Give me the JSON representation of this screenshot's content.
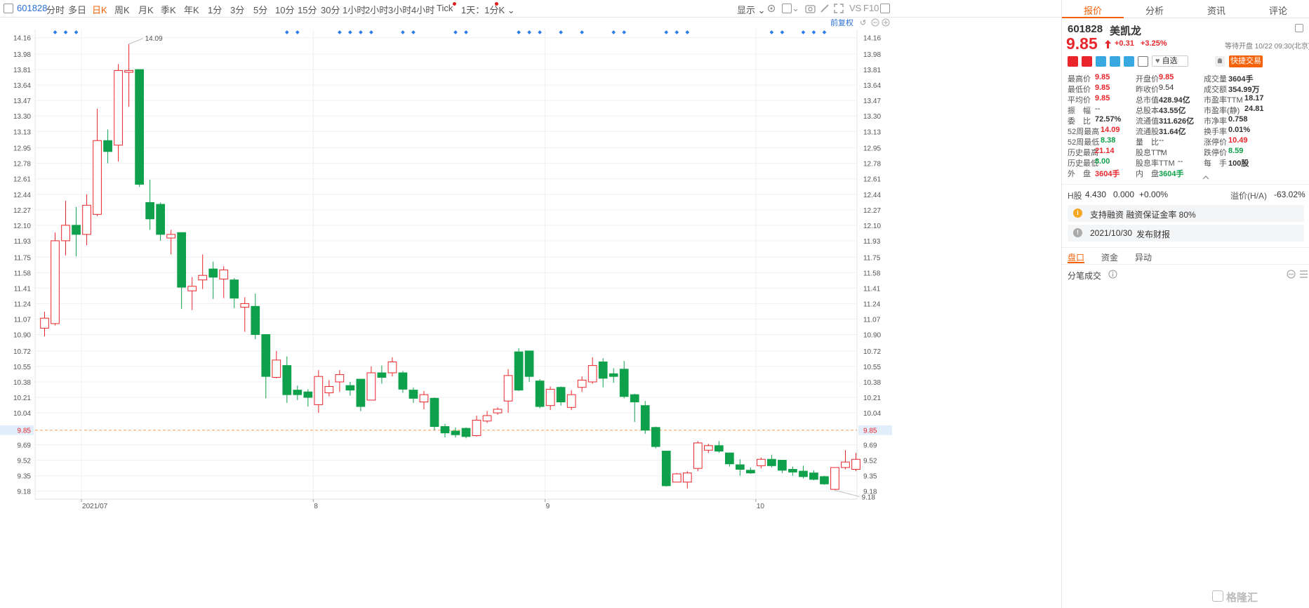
{
  "toolbar": {
    "code": "601828",
    "periods": [
      "分时",
      "多日",
      "日K",
      "周K",
      "月K",
      "季K",
      "年K",
      "1分",
      "3分",
      "5分",
      "10分",
      "15分",
      "30分",
      "1小时",
      "2小时",
      "3小时",
      "4小时",
      "Tick"
    ],
    "active_period": "日K",
    "subperiod": "1天：1分K",
    "display": "显示",
    "vs": "VS",
    "f10": "F10"
  },
  "chart": {
    "adjust_label": "前复权",
    "y_ticks": [
      "14.16",
      "13.98",
      "13.81",
      "13.64",
      "13.47",
      "13.30",
      "13.13",
      "12.95",
      "12.78",
      "12.61",
      "12.44",
      "12.27",
      "12.10",
      "11.93",
      "11.75",
      "11.58",
      "11.41",
      "11.24",
      "11.07",
      "10.90",
      "10.72",
      "10.55",
      "10.38",
      "10.21",
      "10.04",
      "9.85",
      "9.69",
      "9.52",
      "9.35",
      "9.18"
    ],
    "current_price_label": "9.85",
    "x_labels": [
      "2021/07",
      "8",
      "9",
      "10"
    ],
    "high_annotation": "14.09",
    "low_annotation": "9.18"
  },
  "chart_data": {
    "type": "candlestick",
    "ylim": [
      9.1,
      14.25
    ],
    "current_price": 9.85,
    "month_starts": [
      {
        "label": "2021/07",
        "index": 4
      },
      {
        "label": "8",
        "index": 26
      },
      {
        "label": "9",
        "index": 48
      },
      {
        "label": "10",
        "index": 68
      }
    ],
    "candles": [
      [
        10.97,
        11.08,
        11.15,
        10.88
      ],
      [
        11.02,
        11.93,
        12.02,
        11.0
      ],
      [
        11.93,
        12.1,
        12.37,
        11.77
      ],
      [
        12.1,
        12.0,
        12.3,
        11.76
      ],
      [
        12.0,
        12.32,
        12.44,
        11.88
      ],
      [
        12.22,
        13.03,
        13.38,
        12.2
      ],
      [
        13.03,
        12.91,
        13.15,
        12.78
      ],
      [
        12.98,
        13.8,
        13.87,
        12.8
      ],
      [
        13.78,
        13.8,
        14.09,
        13.4
      ],
      [
        13.81,
        12.55,
        13.81,
        12.52
      ],
      [
        12.35,
        12.17,
        12.6,
        12.05
      ],
      [
        12.33,
        12.0,
        12.35,
        11.93
      ],
      [
        11.96,
        12.0,
        12.05,
        11.78
      ],
      [
        12.02,
        11.42,
        12.02,
        11.18
      ],
      [
        11.38,
        11.43,
        11.53,
        11.17
      ],
      [
        11.5,
        11.55,
        11.78,
        11.4
      ],
      [
        11.62,
        11.53,
        11.7,
        11.29
      ],
      [
        11.51,
        11.61,
        11.65,
        11.3
      ],
      [
        11.5,
        11.3,
        11.52,
        11.19
      ],
      [
        11.2,
        11.24,
        11.31,
        10.93
      ],
      [
        11.21,
        10.9,
        11.35,
        10.85
      ],
      [
        10.9,
        10.44,
        10.9,
        10.2
      ],
      [
        10.43,
        10.62,
        10.72,
        10.42
      ],
      [
        10.56,
        10.24,
        10.66,
        10.15
      ],
      [
        10.29,
        10.24,
        10.34,
        10.18
      ],
      [
        10.27,
        10.21,
        10.3,
        10.11
      ],
      [
        10.13,
        10.44,
        10.51,
        10.04
      ],
      [
        10.26,
        10.33,
        10.4,
        10.22
      ],
      [
        10.38,
        10.46,
        10.51,
        10.27
      ],
      [
        10.34,
        10.29,
        10.38,
        10.23
      ],
      [
        10.41,
        10.11,
        10.41,
        10.06
      ],
      [
        10.18,
        10.48,
        10.55,
        10.18
      ],
      [
        10.48,
        10.43,
        10.56,
        10.36
      ],
      [
        10.48,
        10.6,
        10.65,
        10.44
      ],
      [
        10.48,
        10.3,
        10.5,
        10.26
      ],
      [
        10.29,
        10.2,
        10.32,
        10.15
      ],
      [
        10.16,
        10.24,
        10.28,
        10.08
      ],
      [
        10.2,
        9.89,
        10.21,
        9.85
      ],
      [
        9.89,
        9.82,
        9.92,
        9.77
      ],
      [
        9.84,
        9.8,
        9.88,
        9.77
      ],
      [
        9.87,
        9.78,
        9.88,
        9.76
      ],
      [
        9.79,
        9.96,
        10.01,
        9.78
      ],
      [
        9.95,
        10.01,
        10.06,
        9.93
      ],
      [
        10.04,
        10.08,
        10.1,
        10.02
      ],
      [
        10.17,
        10.45,
        10.52,
        10.04
      ],
      [
        10.71,
        10.29,
        10.75,
        10.28
      ],
      [
        10.72,
        10.44,
        10.72,
        10.38
      ],
      [
        10.39,
        10.11,
        10.41,
        10.09
      ],
      [
        10.12,
        10.3,
        10.33,
        10.07
      ],
      [
        10.32,
        10.16,
        10.33,
        10.12
      ],
      [
        10.1,
        10.24,
        10.29,
        10.07
      ],
      [
        10.32,
        10.4,
        10.44,
        10.27
      ],
      [
        10.38,
        10.56,
        10.65,
        10.36
      ],
      [
        10.6,
        10.42,
        10.64,
        10.32
      ],
      [
        10.47,
        10.44,
        10.53,
        10.37
      ],
      [
        10.52,
        10.22,
        10.61,
        10.2
      ],
      [
        10.24,
        10.16,
        10.25,
        9.94
      ],
      [
        10.12,
        9.85,
        10.17,
        9.81
      ],
      [
        9.88,
        9.67,
        9.89,
        9.65
      ],
      [
        9.62,
        9.24,
        9.62,
        9.23
      ],
      [
        9.28,
        9.37,
        9.38,
        9.3
      ],
      [
        9.28,
        9.38,
        9.4,
        9.21
      ],
      [
        9.43,
        9.71,
        9.73,
        9.4
      ],
      [
        9.63,
        9.68,
        9.7,
        9.6
      ],
      [
        9.68,
        9.62,
        9.73,
        9.6
      ],
      [
        9.6,
        9.48,
        9.6,
        9.45
      ],
      [
        9.47,
        9.42,
        9.53,
        9.35
      ],
      [
        9.41,
        9.38,
        9.44,
        9.37
      ],
      [
        9.46,
        9.53,
        9.55,
        9.43
      ],
      [
        9.53,
        9.46,
        9.58,
        9.44
      ],
      [
        9.52,
        9.41,
        9.52,
        9.38
      ],
      [
        9.42,
        9.39,
        9.45,
        9.35
      ],
      [
        9.4,
        9.34,
        9.46,
        9.32
      ],
      [
        9.38,
        9.31,
        9.41,
        9.3
      ],
      [
        9.34,
        9.26,
        9.35,
        9.25
      ],
      [
        9.2,
        9.44,
        9.44,
        9.19
      ],
      [
        9.44,
        9.5,
        9.63,
        9.42
      ],
      [
        9.42,
        9.53,
        9.6,
        9.4
      ]
    ]
  },
  "panel": {
    "tabs": [
      "报价",
      "分析",
      "资讯",
      "评论"
    ],
    "active_tab": "报价",
    "code": "601828",
    "name": "美凯龙",
    "price": "9.85",
    "change": "+0.31",
    "change_pct": "+3.25%",
    "status": "等待开盘 10/22 09:30(北京)",
    "watch_label": "自选",
    "quick_trade": "快捷交易",
    "stats": [
      [
        {
          "label": "最高价",
          "value": "9.85",
          "color": "red"
        },
        {
          "label": "开盘价",
          "value": "9.85",
          "color": "red"
        },
        {
          "label": "成交量",
          "value": "3604手",
          "color": "dark"
        }
      ],
      [
        {
          "label": "最低价",
          "value": "9.85",
          "color": "red"
        },
        {
          "label": "昨收价",
          "value": "9.54",
          "color": "plain"
        },
        {
          "label": "成交额",
          "value": "354.99万",
          "color": "dark"
        }
      ],
      [
        {
          "label": "平均价",
          "value": "9.85",
          "color": "red"
        },
        {
          "label": "总市值",
          "value": "428.94亿",
          "color": "dark"
        },
        {
          "label": "市盈率TTM",
          "value": "18.17",
          "color": "dark"
        }
      ],
      [
        {
          "label": "振　幅",
          "value": "--",
          "color": "plain"
        },
        {
          "label": "总股本",
          "value": "43.55亿",
          "color": "dark"
        },
        {
          "label": "市盈率(静)",
          "value": "24.81",
          "color": "dark"
        }
      ],
      [
        {
          "label": "委　比",
          "value": "72.57%",
          "color": "dark"
        },
        {
          "label": "流通值",
          "value": "311.626亿",
          "color": "dark"
        },
        {
          "label": "市净率",
          "value": "0.758",
          "color": "dark"
        }
      ],
      [
        {
          "label": "52周最高",
          "value": "14.09",
          "color": "red"
        },
        {
          "label": "流通股",
          "value": "31.64亿",
          "color": "dark"
        },
        {
          "label": "换手率",
          "value": "0.01%",
          "color": "dark"
        }
      ],
      [
        {
          "label": "52周最低",
          "value": "8.38",
          "color": "green"
        },
        {
          "label": "量　比",
          "value": "--",
          "color": "plain"
        },
        {
          "label": "涨停价",
          "value": "10.49",
          "color": "red"
        }
      ],
      [
        {
          "label": "历史最高",
          "value": "21.14",
          "color": "red"
        },
        {
          "label": "股息TTM",
          "value": "--",
          "color": "plain"
        },
        {
          "label": "跌停价",
          "value": "8.59",
          "color": "green"
        }
      ],
      [
        {
          "label": "历史最低",
          "value": "8.00",
          "color": "green"
        },
        {
          "label": "股息率TTM",
          "value": "--",
          "color": "plain"
        },
        {
          "label": "每　手",
          "value": "100股",
          "color": "dark"
        }
      ],
      [
        {
          "label": "外　盘",
          "value": "3604手",
          "color": "red"
        },
        {
          "label": "内　盘",
          "value": "3604手",
          "color": "green"
        }
      ]
    ],
    "hshare": {
      "label": "H股",
      "price": "4.430",
      "change": "0.000",
      "pct": "+0.00%",
      "premium_label": "溢价(H/A)",
      "premium": "-63.02%"
    },
    "margin_text": "支持融资 融资保证金率 80%",
    "report_date": "2021/10/30",
    "report_text": "发布财报",
    "subtabs": [
      "盘口",
      "资金",
      "异动"
    ],
    "active_subtab": "盘口",
    "ticks_title": "分笔成交",
    "watermark": "格隆汇"
  }
}
